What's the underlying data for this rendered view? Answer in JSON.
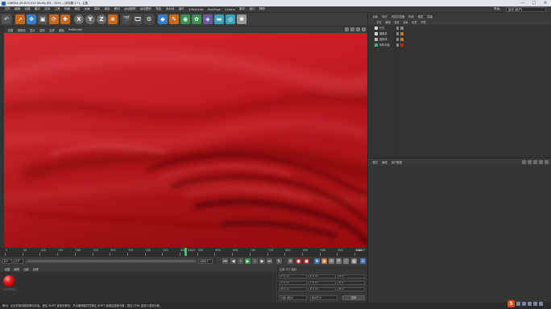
{
  "window": {
    "title": "CINEMA 4D R19.024 Studio (RC - R19) - [未标题 1 *] - 主要",
    "controls": [
      "—",
      "□",
      "✕"
    ]
  },
  "menubar": {
    "items": [
      "文件",
      "编辑",
      "创建",
      "模式",
      "选择",
      "工具",
      "网格",
      "捕捉",
      "动画",
      "模拟",
      "渲染",
      "雕刻",
      "运动跟踪",
      "运动图形",
      "角色",
      "流水线",
      "插件",
      "X-Particles",
      "RealFlow",
      "Octane",
      "脚本",
      "窗口",
      "帮助"
    ],
    "layout_label": "界面:",
    "layout_value": "启动 (用户)"
  },
  "toolbar": {
    "axis_x": "X",
    "axis_y": "Y",
    "axis_z": "Z"
  },
  "viewport_menu": {
    "items": [
      "查看",
      "摄像机",
      "显示",
      "选项",
      "过滤",
      "面板",
      "ProRender"
    ]
  },
  "viewport": {
    "cloth_color": "#c0161c"
  },
  "timeline": {
    "ticks": [
      "0",
      "50",
      "100",
      "150",
      "200",
      "250",
      "300",
      "350",
      "400",
      "450",
      "500",
      "550",
      "600",
      "650",
      "700",
      "750",
      "800",
      "850",
      "900",
      "950",
      "1000"
    ],
    "current_frame": "514 F",
    "end_frame": "1000 F",
    "progress": 0.514
  },
  "transport": {
    "start_field": "0 F",
    "start_field2": "0 F",
    "end_field": "1000 F",
    "end_field2": "1000 F"
  },
  "material_manager": {
    "menu": [
      "创建",
      "编辑",
      "功能",
      "纹理"
    ]
  },
  "coordinates": {
    "header": "位置            尺寸            旋转",
    "rows": [
      [
        "X  0 cm",
        "X  0 cm",
        "H  0 °"
      ],
      [
        "Y  0 cm",
        "Y  0 cm",
        "P  0 °"
      ],
      [
        "Z  0 cm",
        "Z  0 cm",
        "B  0 °"
      ]
    ],
    "world_select": "对象 (相对)",
    "size_select": "绝对尺寸",
    "apply_label": "应用"
  },
  "object_manager": {
    "tabs": [
      "对象",
      "场次",
      "内容浏览器",
      "构造",
      "图层",
      "层级"
    ],
    "menu": [
      "文件",
      "编辑",
      "查看",
      "对象",
      "标签",
      "书签"
    ],
    "objects": [
      {
        "name": "灯光",
        "icon_color": "#d8d8d8",
        "tag_color": "#888888"
      },
      {
        "name": "摄像机",
        "icon_color": "#d8d8d8",
        "tag_color": "#c07a2a"
      },
      {
        "name": "碰撞体",
        "icon_color": "#bbbbbb",
        "tag_color": "#c07a2a"
      },
      {
        "name": "布料平面",
        "icon_color": "#3bb37a",
        "tag_color": "#cc1a1a"
      }
    ]
  },
  "attribute_manager": {
    "menu": [
      "模式",
      "编辑",
      "用户数据"
    ]
  },
  "statusbar": {
    "text": "移动：点击并拖动鼠标移动元素。按住 SHIFT 键量化移动；节点编辑模式时按住 SHIFT 键增加选择对象；按住 CTRL 键减少选择对象。"
  },
  "tray": {
    "s_logo": "S"
  }
}
